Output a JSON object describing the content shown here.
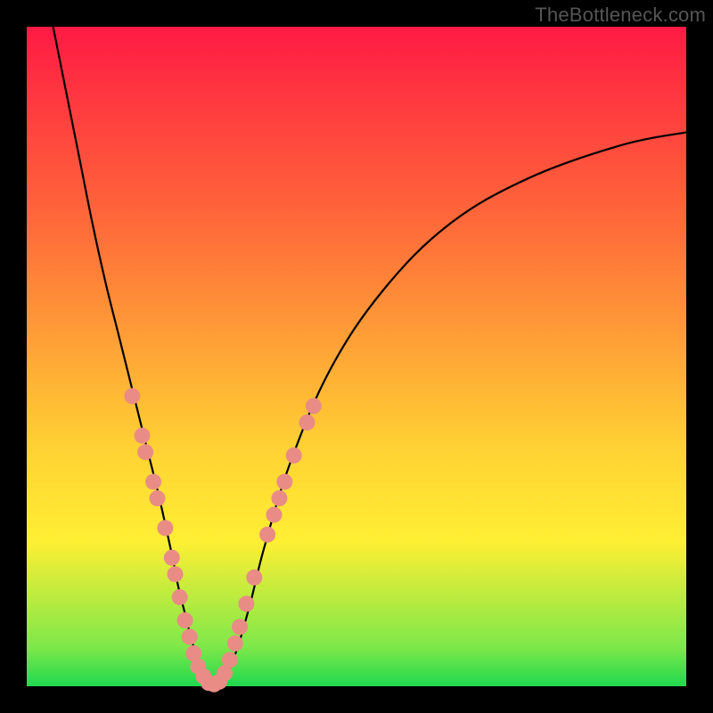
{
  "watermark": {
    "text": "TheBottleneck.com"
  },
  "chart_data": {
    "type": "line",
    "title": "",
    "xlabel": "",
    "ylabel": "",
    "xlim": [
      0,
      100
    ],
    "ylim": [
      0,
      100
    ],
    "series": [
      {
        "name": "bottleneck-v-curve",
        "x": [
          4,
          6,
          8,
          10,
          12,
          14,
          16,
          18,
          20,
          22,
          23,
          24,
          25,
          26,
          27,
          28,
          29,
          30,
          32,
          34,
          36,
          40,
          46,
          54,
          64,
          76,
          90,
          100
        ],
        "y": [
          100,
          90,
          80,
          70,
          61,
          53,
          45,
          37,
          29,
          20,
          15,
          11,
          7,
          4,
          2,
          0,
          0,
          1,
          6,
          13,
          21,
          34,
          48,
          60,
          70,
          77,
          82,
          84
        ]
      }
    ],
    "markers": [
      {
        "name": "left-cluster-1",
        "x": 16.0,
        "y": 44.0
      },
      {
        "name": "left-cluster-2",
        "x": 17.5,
        "y": 38.0
      },
      {
        "name": "left-cluster-3",
        "x": 18.0,
        "y": 35.5
      },
      {
        "name": "left-cluster-4",
        "x": 19.2,
        "y": 31.0
      },
      {
        "name": "left-cluster-5",
        "x": 19.8,
        "y": 28.5
      },
      {
        "name": "left-cluster-6",
        "x": 21.0,
        "y": 24.0
      },
      {
        "name": "left-cluster-7",
        "x": 22.0,
        "y": 19.5
      },
      {
        "name": "left-cluster-8",
        "x": 22.5,
        "y": 17.0
      },
      {
        "name": "left-cluster-9",
        "x": 23.2,
        "y": 13.5
      },
      {
        "name": "left-cluster-10",
        "x": 24.0,
        "y": 10.0
      },
      {
        "name": "left-cluster-11",
        "x": 24.7,
        "y": 7.5
      },
      {
        "name": "left-cluster-12",
        "x": 25.3,
        "y": 5.0
      },
      {
        "name": "left-cluster-13",
        "x": 26.0,
        "y": 3.0
      },
      {
        "name": "bottom-1",
        "x": 26.8,
        "y": 1.5
      },
      {
        "name": "bottom-2",
        "x": 27.6,
        "y": 0.5
      },
      {
        "name": "bottom-3",
        "x": 28.4,
        "y": 0.3
      },
      {
        "name": "bottom-4",
        "x": 29.2,
        "y": 0.7
      },
      {
        "name": "right-cluster-1",
        "x": 30.0,
        "y": 2.0
      },
      {
        "name": "right-cluster-2",
        "x": 30.8,
        "y": 4.0
      },
      {
        "name": "right-cluster-3",
        "x": 31.6,
        "y": 6.5
      },
      {
        "name": "right-cluster-4",
        "x": 32.3,
        "y": 9.0
      },
      {
        "name": "right-cluster-5",
        "x": 33.3,
        "y": 12.5
      },
      {
        "name": "right-cluster-6",
        "x": 34.5,
        "y": 16.5
      },
      {
        "name": "right-cluster-7",
        "x": 36.5,
        "y": 23.0
      },
      {
        "name": "right-cluster-8",
        "x": 37.5,
        "y": 26.0
      },
      {
        "name": "right-cluster-9",
        "x": 38.3,
        "y": 28.5
      },
      {
        "name": "right-cluster-10",
        "x": 39.1,
        "y": 31.0
      },
      {
        "name": "right-cluster-11",
        "x": 40.5,
        "y": 35.0
      },
      {
        "name": "right-cluster-12",
        "x": 42.5,
        "y": 40.0
      },
      {
        "name": "right-cluster-13",
        "x": 43.5,
        "y": 42.5
      }
    ],
    "marker_radius_px": 9,
    "background_gradient": {
      "direction": "top-to-bottom",
      "stops": [
        {
          "pos": 0.0,
          "color": "#ff1a44"
        },
        {
          "pos": 0.12,
          "color": "#ff3b3f"
        },
        {
          "pos": 0.3,
          "color": "#ff6a3a"
        },
        {
          "pos": 0.48,
          "color": "#ffa136"
        },
        {
          "pos": 0.64,
          "color": "#ffd233"
        },
        {
          "pos": 0.78,
          "color": "#ffef33"
        },
        {
          "pos": 0.94,
          "color": "#7fe84a"
        },
        {
          "pos": 1.0,
          "color": "#1fd94f"
        }
      ]
    }
  }
}
